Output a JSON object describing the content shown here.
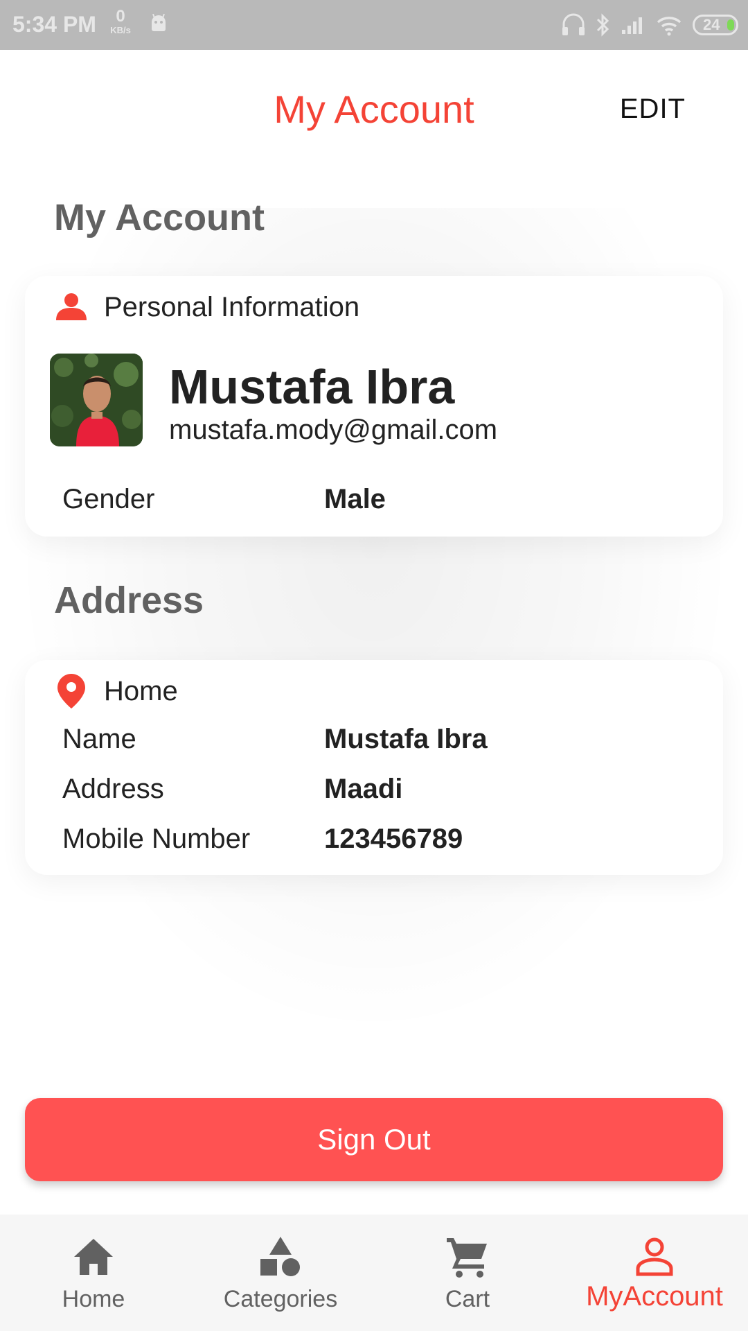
{
  "status_bar": {
    "time": "5:34 PM",
    "speed_value": "0",
    "speed_unit": "KB/s",
    "battery": "24"
  },
  "app_bar": {
    "title": "My Account",
    "edit_label": "EDIT"
  },
  "account_section": {
    "title": "My Account",
    "card_header": "Personal Information",
    "name": "Mustafa Ibra",
    "email": "mustafa.mody@gmail.com",
    "gender_label": "Gender",
    "gender_value": "Male"
  },
  "address_section": {
    "title": "Address",
    "card_header": "Home",
    "rows": [
      {
        "label": "Name",
        "value": "Mustafa Ibra"
      },
      {
        "label": "Address",
        "value": "Maadi"
      },
      {
        "label": "Mobile Number",
        "value": "123456789"
      }
    ]
  },
  "sign_out_label": "Sign Out",
  "bottom_nav": {
    "items": [
      {
        "label": "Home",
        "icon": "home-icon"
      },
      {
        "label": "Categories",
        "icon": "categories-icon"
      },
      {
        "label": "Cart",
        "icon": "cart-icon"
      },
      {
        "label": "MyAccount",
        "icon": "account-icon"
      }
    ],
    "active_index": 3
  },
  "colors": {
    "accent": "#f44336",
    "button": "#ff5252",
    "status_bar": "#b9b9b9",
    "section_title": "#616161"
  }
}
